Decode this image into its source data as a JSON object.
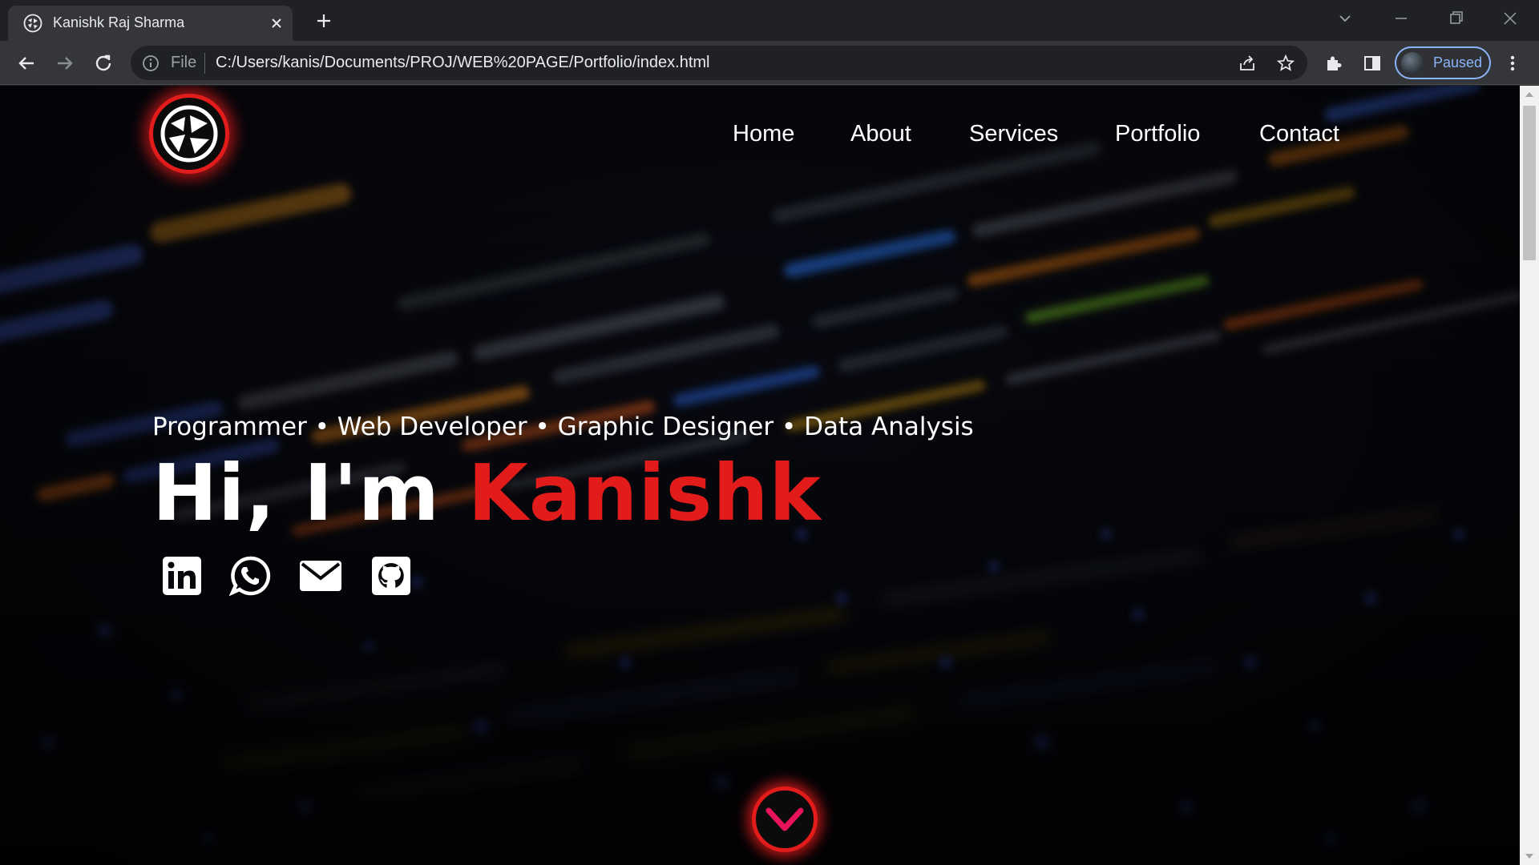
{
  "browser": {
    "tab_title": "Kanishk Raj Sharma",
    "address_scheme": "File",
    "address_url": "C:/Users/kanis/Documents/PROJ/WEB%20PAGE/Portfolio/index.html",
    "profile_label": "Paused"
  },
  "site": {
    "nav": [
      "Home",
      "About",
      "Services",
      "Portfolio",
      "Contact"
    ],
    "subtitle": "Programmer • Web Developer • Graphic Designer • Data Analysis",
    "greeting": "Hi, I'm ",
    "name": "Kanishk",
    "social_icons": [
      "linkedin-icon",
      "whatsapp-icon",
      "email-icon",
      "github-icon"
    ],
    "accent_color": "#e21b1b"
  }
}
